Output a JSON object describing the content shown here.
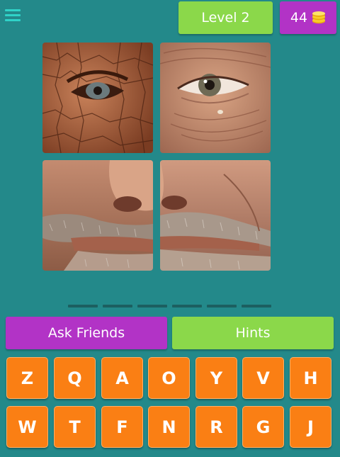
{
  "header": {
    "level_label": "Level 2",
    "coins": "44"
  },
  "puzzle": {
    "answer_slots": 6
  },
  "actions": {
    "ask_friends": "Ask Friends",
    "hints": "Hints"
  },
  "keyboard": {
    "row1": [
      "Z",
      "Q",
      "A",
      "O",
      "Y",
      "V",
      "H"
    ],
    "row2": [
      "W",
      "T",
      "F",
      "N",
      "R",
      "G",
      "J"
    ]
  },
  "colors": {
    "background": "#23898a",
    "green": "#8bd84a",
    "purple": "#b233c6",
    "orange": "#fa7f14"
  }
}
